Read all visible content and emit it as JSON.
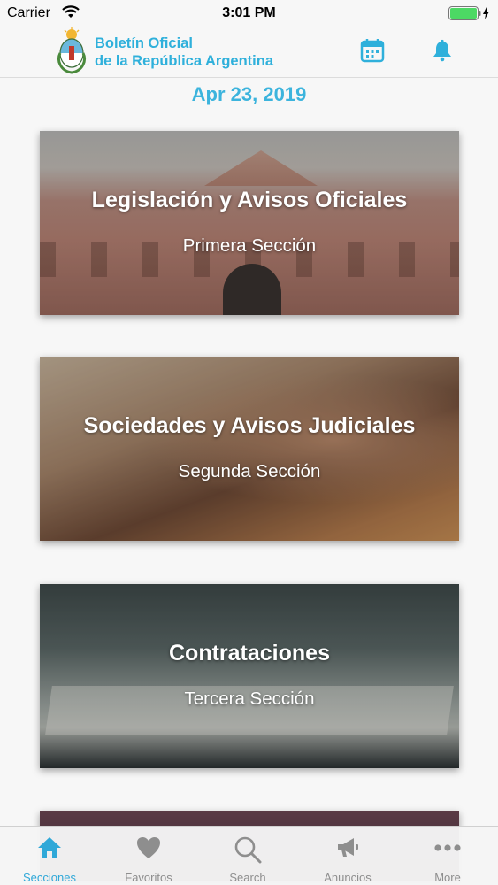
{
  "status_bar": {
    "carrier": "Carrier",
    "time": "3:01 PM",
    "wifi_icon": "wifi-icon",
    "battery_icon": "battery-charging-icon"
  },
  "header": {
    "brand_line_1": "Boletín Oficial",
    "brand_line_2": "de la República Argentina",
    "logo": "coat-of-arms-logo",
    "calendar_icon": "calendar-icon",
    "bell_icon": "bell-icon",
    "accent_color": "#2fb0db"
  },
  "date": "Apr 23, 2019",
  "sections": [
    {
      "title": "Legislación y Avisos Oficiales",
      "subtitle": "Primera Sección"
    },
    {
      "title": "Sociedades y Avisos Judiciales",
      "subtitle": "Segunda Sección"
    },
    {
      "title": "Contrataciones",
      "subtitle": "Tercera Sección"
    }
  ],
  "tabs": [
    {
      "label": "Secciones",
      "icon": "home-icon",
      "active": true
    },
    {
      "label": "Favoritos",
      "icon": "heart-icon",
      "active": false
    },
    {
      "label": "Search",
      "icon": "search-icon",
      "active": false
    },
    {
      "label": "Anuncios",
      "icon": "megaphone-icon",
      "active": false
    },
    {
      "label": "More",
      "icon": "more-icon",
      "active": false
    }
  ],
  "colors": {
    "active_tab": "#2fa8d8",
    "inactive_tab": "#8e8e8e",
    "date": "#3cb4dd"
  }
}
